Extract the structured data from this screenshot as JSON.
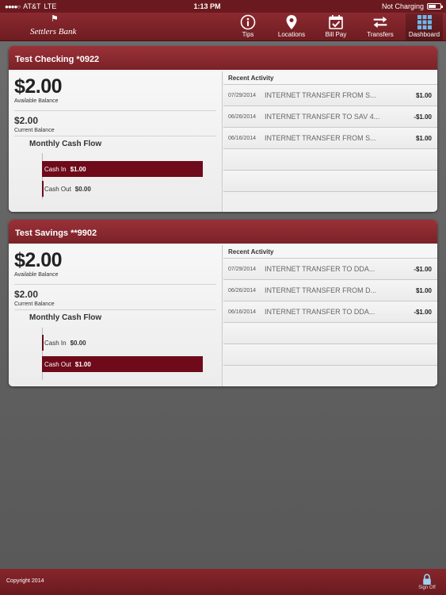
{
  "status": {
    "carrier": "AT&T",
    "network": "LTE",
    "time": "1:13 PM",
    "charging": "Not Charging"
  },
  "nav": {
    "logo_text": "Settlers Bank",
    "tips": "Tips",
    "locations": "Locations",
    "bill_pay": "Bill Pay",
    "transfers": "Transfers",
    "dashboard": "Dashboard",
    "active": "dashboard"
  },
  "accounts": [
    {
      "name": "Test Checking *0922",
      "available_balance": "$2.00",
      "available_label": "Available Balance",
      "current_balance": "$2.00",
      "current_label": "Current Balance",
      "cash_flow_title": "Monthly Cash Flow",
      "cash_in_label": "Cash In",
      "cash_in": "$1.00",
      "cash_in_fraction": 1.0,
      "cash_out_label": "Cash Out",
      "cash_out": "$0.00",
      "cash_out_fraction": 0.0,
      "recent_title": "Recent Activity",
      "activity": [
        {
          "date": "07/29/2014",
          "desc": "INTERNET TRANSFER FROM S...",
          "amount": "$1.00"
        },
        {
          "date": "06/26/2014",
          "desc": "INTERNET TRANSFER TO SAV 4...",
          "amount": "-$1.00"
        },
        {
          "date": "06/16/2014",
          "desc": "INTERNET TRANSFER FROM S...",
          "amount": "$1.00"
        }
      ]
    },
    {
      "name": "Test Savings **9902",
      "available_balance": "$2.00",
      "available_label": "Available Balance",
      "current_balance": "$2.00",
      "current_label": "Current Balance",
      "cash_flow_title": "Monthly Cash Flow",
      "cash_in_label": "Cash In",
      "cash_in": "$0.00",
      "cash_in_fraction": 0.0,
      "cash_out_label": "Cash Out",
      "cash_out": "$1.00",
      "cash_out_fraction": 1.0,
      "recent_title": "Recent Activity",
      "activity": [
        {
          "date": "07/29/2014",
          "desc": "INTERNET TRANSFER TO DDA...",
          "amount": "-$1.00"
        },
        {
          "date": "06/26/2014",
          "desc": "INTERNET TRANSFER FROM D...",
          "amount": "$1.00"
        },
        {
          "date": "06/16/2014",
          "desc": "INTERNET TRANSFER TO DDA...",
          "amount": "-$1.00"
        }
      ]
    }
  ],
  "footer": {
    "copyright": "Copyright 2014",
    "sign_off": "Sign Off"
  },
  "colors": {
    "brand": "#7a2228",
    "bar": "#6e0a1a"
  }
}
